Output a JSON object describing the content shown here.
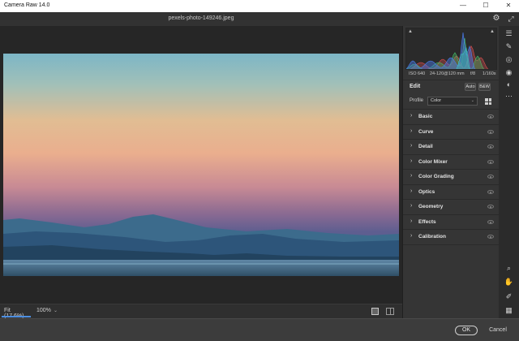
{
  "window": {
    "app_title": "Camera Raw 14.0",
    "controls": {
      "minimize": "—",
      "maximize": "☐",
      "close": "✕"
    }
  },
  "header": {
    "file_name": "pexels-photo-149246.jpeg",
    "settings_icon": "gear-icon",
    "fullscreen_icon": "fullscreen-icon"
  },
  "histogram": {
    "colors": {
      "red": "#e05050",
      "green": "#46c06a",
      "blue": "#4a7cf0",
      "cyan": "#40c0c0"
    }
  },
  "metadata": {
    "iso": "ISO 640",
    "lens": "24-120@120 mm",
    "aperture": "f/8",
    "shutter": "1/160s"
  },
  "edit": {
    "title": "Edit",
    "auto_label": "Auto",
    "bw_label": "B&W",
    "profile_label": "Profile",
    "profile_value": "Color"
  },
  "sections": [
    {
      "label": "Basic"
    },
    {
      "label": "Curve"
    },
    {
      "label": "Detail"
    },
    {
      "label": "Color Mixer"
    },
    {
      "label": "Color Grading"
    },
    {
      "label": "Optics"
    },
    {
      "label": "Geometry"
    },
    {
      "label": "Effects"
    },
    {
      "label": "Calibration"
    }
  ],
  "bottombar": {
    "zoom_fit": "Fit (17.6%)",
    "zoom_100": "100%"
  },
  "footer": {
    "ok_label": "OK",
    "cancel_label": "Cancel"
  },
  "tools": {
    "top": [
      "sliders-icon",
      "brush-icon",
      "redeye-icon",
      "eye-icon",
      "mask-icon",
      "more-icon"
    ],
    "bottom": [
      "zoom-icon",
      "hand-icon",
      "sampler-icon",
      "grid-icon"
    ]
  }
}
